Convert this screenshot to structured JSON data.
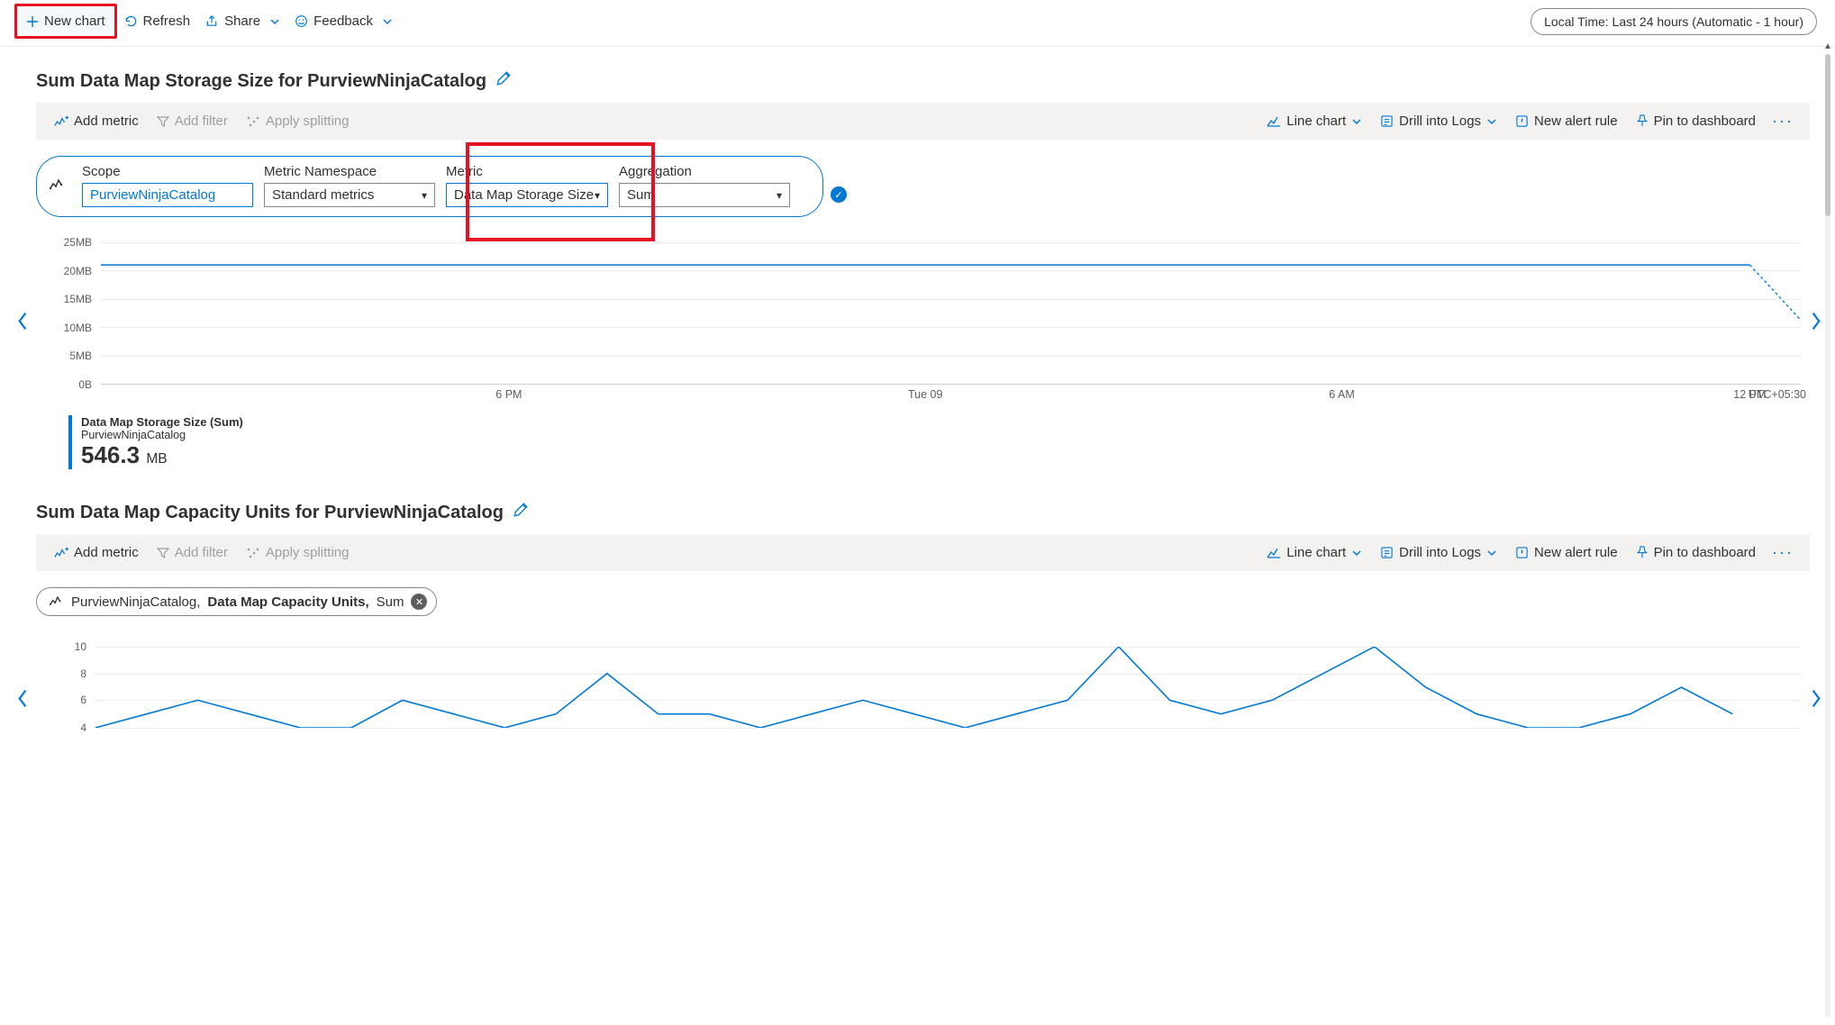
{
  "toolbar": {
    "new_chart": "New chart",
    "refresh": "Refresh",
    "share": "Share",
    "feedback": "Feedback",
    "time_range": "Local Time: Last 24 hours (Automatic - 1 hour)"
  },
  "chart1": {
    "title": "Sum Data Map Storage Size for PurviewNinjaCatalog",
    "cmds": {
      "add_metric": "Add metric",
      "add_filter": "Add filter",
      "apply_splitting": "Apply splitting",
      "line_chart": "Line chart",
      "drill_logs": "Drill into Logs",
      "new_alert": "New alert rule",
      "pin_dashboard": "Pin to dashboard"
    },
    "selectors": {
      "scope_label": "Scope",
      "scope_value": "PurviewNinjaCatalog",
      "ns_label": "Metric Namespace",
      "ns_value": "Standard metrics",
      "metric_label": "Metric",
      "metric_value": "Data Map Storage Size",
      "agg_label": "Aggregation",
      "agg_value": "Sum"
    },
    "legend": {
      "label": "Data Map Storage Size (Sum)",
      "sub": "PurviewNinjaCatalog",
      "value": "546.3",
      "unit": "MB"
    },
    "tz": "UTC+05:30"
  },
  "chart2": {
    "title": "Sum Data Map Capacity Units for PurviewNinjaCatalog",
    "cmds": {
      "add_metric": "Add metric",
      "add_filter": "Add filter",
      "apply_splitting": "Apply splitting",
      "line_chart": "Line chart",
      "drill_logs": "Drill into Logs",
      "new_alert": "New alert rule",
      "pin_dashboard": "Pin to dashboard"
    },
    "chip": {
      "scope": "PurviewNinjaCatalog, ",
      "metric": "Data Map Capacity Units, ",
      "agg": "Sum"
    }
  },
  "chart_data": [
    {
      "type": "line",
      "title": "Sum Data Map Storage Size for PurviewNinjaCatalog",
      "xlabel": "",
      "ylabel": "",
      "ylim": [
        0,
        25
      ],
      "y_unit": "MB",
      "y_ticks": [
        "25MB",
        "20MB",
        "15MB",
        "10MB",
        "5MB",
        "0B"
      ],
      "x_ticks": [
        "6 PM",
        "Tue 09",
        "6 AM",
        "12 PM"
      ],
      "series": [
        {
          "name": "Data Map Storage Size (Sum) — PurviewNinjaCatalog",
          "points": [
            {
              "x": "12 PM (prev)",
              "y": 21
            },
            {
              "x": "1 PM",
              "y": 21
            },
            {
              "x": "2 PM",
              "y": 21
            },
            {
              "x": "3 PM",
              "y": 21
            },
            {
              "x": "4 PM",
              "y": 21
            },
            {
              "x": "5 PM",
              "y": 21
            },
            {
              "x": "6 PM",
              "y": 21
            },
            {
              "x": "7 PM",
              "y": 21
            },
            {
              "x": "8 PM",
              "y": 21
            },
            {
              "x": "9 PM",
              "y": 21
            },
            {
              "x": "10 PM",
              "y": 21
            },
            {
              "x": "11 PM",
              "y": 21
            },
            {
              "x": "Tue 09",
              "y": 21
            },
            {
              "x": "1 AM",
              "y": 21
            },
            {
              "x": "2 AM",
              "y": 21
            },
            {
              "x": "3 AM",
              "y": 21
            },
            {
              "x": "4 AM",
              "y": 21
            },
            {
              "x": "5 AM",
              "y": 21
            },
            {
              "x": "6 AM",
              "y": 21
            },
            {
              "x": "7 AM",
              "y": 21
            },
            {
              "x": "8 AM",
              "y": 21
            },
            {
              "x": "9 AM",
              "y": 21
            },
            {
              "x": "10 AM",
              "y": 21
            },
            {
              "x": "11 AM",
              "y": 21
            },
            {
              "x": "12 PM",
              "y": 21
            }
          ],
          "trailing_dashed_drop": true,
          "sum_display": "546.3 MB"
        }
      ]
    },
    {
      "type": "line",
      "title": "Sum Data Map Capacity Units for PurviewNinjaCatalog",
      "xlabel": "",
      "ylabel": "",
      "ylim": [
        4,
        10
      ],
      "y_ticks": [
        "10",
        "8",
        "6",
        "4"
      ],
      "series": [
        {
          "name": "Data Map Capacity Units (Sum) — PurviewNinjaCatalog",
          "points": [
            {
              "x": 0,
              "y": 4
            },
            {
              "x": 1,
              "y": 5
            },
            {
              "x": 2,
              "y": 6
            },
            {
              "x": 3,
              "y": 5
            },
            {
              "x": 4,
              "y": 4
            },
            {
              "x": 5,
              "y": 4
            },
            {
              "x": 6,
              "y": 6
            },
            {
              "x": 7,
              "y": 5
            },
            {
              "x": 8,
              "y": 4
            },
            {
              "x": 9,
              "y": 5
            },
            {
              "x": 10,
              "y": 8
            },
            {
              "x": 11,
              "y": 5
            },
            {
              "x": 12,
              "y": 5
            },
            {
              "x": 13,
              "y": 4
            },
            {
              "x": 14,
              "y": 5
            },
            {
              "x": 15,
              "y": 6
            },
            {
              "x": 16,
              "y": 5
            },
            {
              "x": 17,
              "y": 4
            },
            {
              "x": 18,
              "y": 5
            },
            {
              "x": 19,
              "y": 6
            },
            {
              "x": 20,
              "y": 10
            },
            {
              "x": 21,
              "y": 6
            },
            {
              "x": 22,
              "y": 5
            },
            {
              "x": 23,
              "y": 6
            },
            {
              "x": 24,
              "y": 8
            },
            {
              "x": 25,
              "y": 10
            },
            {
              "x": 26,
              "y": 7
            },
            {
              "x": 27,
              "y": 5
            },
            {
              "x": 28,
              "y": 4
            },
            {
              "x": 29,
              "y": 4
            },
            {
              "x": 30,
              "y": 5
            },
            {
              "x": 31,
              "y": 7
            },
            {
              "x": 32,
              "y": 5
            }
          ]
        }
      ]
    }
  ]
}
